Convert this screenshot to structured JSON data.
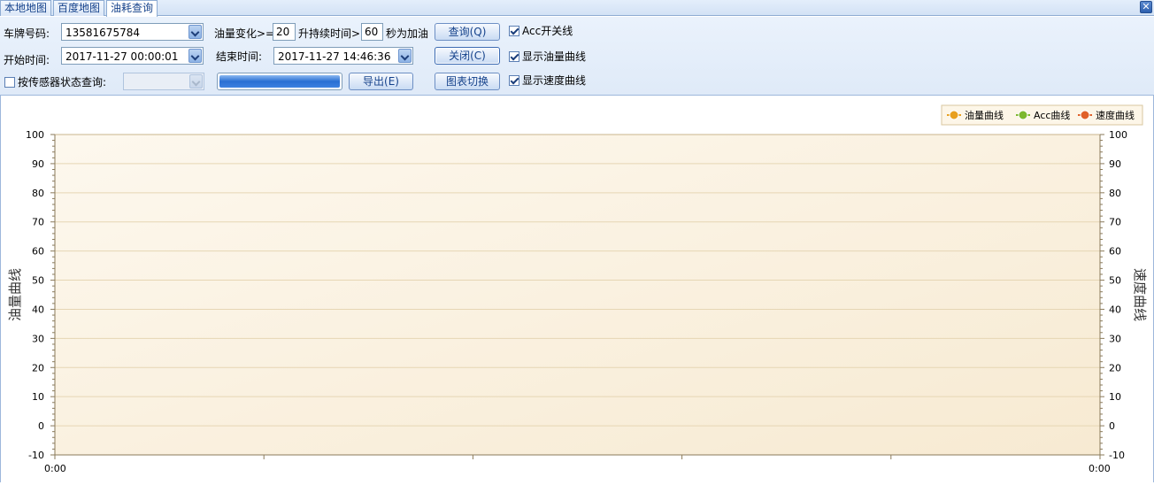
{
  "tabs": [
    {
      "label": "本地地图",
      "active": false
    },
    {
      "label": "百度地图",
      "active": false
    },
    {
      "label": "油耗查询",
      "active": true
    }
  ],
  "toolbar": {
    "plate_label": "车牌号码:",
    "plate_value": "13581675784",
    "oil_change_label": "油量变化>=",
    "oil_change_value": "20",
    "duration_label": "升持续时间>",
    "duration_value": "60",
    "refuel_label": "秒为加油",
    "query_button": "查询(Q)",
    "acc_checkbox": {
      "label": "Acc开关线",
      "checked": true
    },
    "start_label": "开始时间:",
    "start_value": "2017-11-27 00:00:01",
    "end_label": "结束时间:",
    "end_value": "2017-11-27 14:46:36",
    "close_button": "关闭(C)",
    "oil_curve_checkbox": {
      "label": "显示油量曲线",
      "checked": true
    },
    "sensor_checkbox": {
      "label": "按传感器状态查询:",
      "checked": false
    },
    "sensor_select_value": "",
    "progress": 1.0,
    "export_button": "导出(E)",
    "switch_chart_button": "图表切换",
    "speed_curve_checkbox": {
      "label": "显示速度曲线",
      "checked": true
    }
  },
  "colors": {
    "oil": "#e8a020",
    "acc": "#7cb82f",
    "speed": "#e0602a"
  },
  "chart_data": {
    "type": "line",
    "series": [
      {
        "name": "油量曲线",
        "values": []
      },
      {
        "name": "Acc曲线",
        "values": []
      },
      {
        "name": "速度曲线",
        "values": []
      }
    ],
    "x_start_label": "0:00",
    "x_end_label": "0:00",
    "ylabel_left": "油量曲线",
    "ylabel_right": "速度曲线",
    "yticks": [
      100,
      90,
      80,
      70,
      60,
      50,
      40,
      30,
      20,
      10,
      0,
      -10
    ],
    "ylim": [
      -10,
      100
    ],
    "grid": true,
    "legend_position": "top-right"
  }
}
